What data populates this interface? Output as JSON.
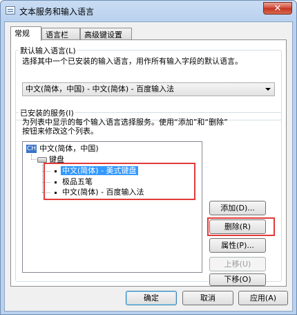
{
  "window": {
    "title": "文本服务和输入语言",
    "close_label": "✕"
  },
  "tabs": [
    {
      "label": "常规",
      "active": true
    },
    {
      "label": "语言栏",
      "active": false
    },
    {
      "label": "高级键设置",
      "active": false
    }
  ],
  "default_lang": {
    "group_label": "默认输入语言(L)",
    "description": "选择其中一个已安装的输入语言，用作所有输入字段的默认语言。",
    "selected": "中文(简体，中国) - 中文(简体) - 百度输入法"
  },
  "installed": {
    "group_label": "已安装的服务(I)",
    "description_line1": "为列表中显示的每个输入语言选择服务。使用“添加”和“删除”",
    "description_line2": "按钮来修改这个列表。",
    "tree": {
      "lang_badge": "CH",
      "language": "中文(简体，中国)",
      "category": "键盘",
      "items": [
        {
          "label": "中文(简体) - 美式键盘",
          "selected": true
        },
        {
          "label": "极品五笔",
          "selected": false
        },
        {
          "label": "中文(简体) - 百度输入法",
          "selected": false
        }
      ]
    },
    "buttons": {
      "add": "添加(D)...",
      "remove": "删除(R)",
      "properties": "属性(P)...",
      "move_up": "上移(U)",
      "move_down": "下移(O)"
    }
  },
  "footer": {
    "ok": "确定",
    "cancel": "取消",
    "apply": "应用(A)"
  },
  "colors": {
    "highlight_box": "#e23a3a",
    "selection": "#3399ff"
  }
}
